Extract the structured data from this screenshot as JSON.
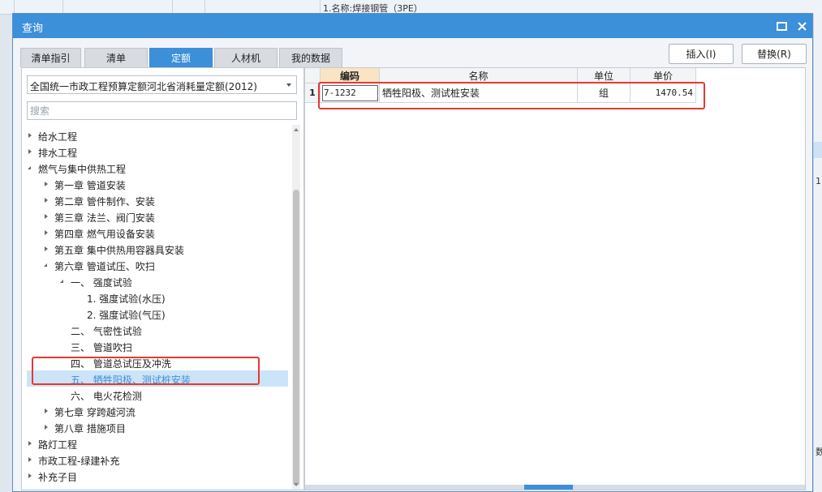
{
  "background": {
    "top_row_text": "1.名称:焊接钢管（3PE）",
    "right_texts": [
      "1",
      "数"
    ]
  },
  "dialog": {
    "title": "查询",
    "tabs": [
      {
        "label": "清单指引",
        "active": false
      },
      {
        "label": "清单",
        "active": false
      },
      {
        "label": "定额",
        "active": true
      },
      {
        "label": "人材机",
        "active": false
      },
      {
        "label": "我的数据",
        "active": false
      }
    ],
    "insert_label": "插入(I)",
    "replace_label": "替换(R)"
  },
  "left": {
    "library": "全国统一市政工程预算定额河北省消耗量定额(2012)",
    "search_placeholder": "搜索",
    "tree": [
      {
        "label": "给水工程",
        "toggle": "closed",
        "selected": false
      },
      {
        "label": "排水工程",
        "toggle": "closed",
        "selected": false
      },
      {
        "label": "燃气与集中供热工程",
        "toggle": "open",
        "selected": false
      },
      {
        "label": "第一章 管道安装",
        "toggle": "closed",
        "selected": false
      },
      {
        "label": "第二章 管件制作、安装",
        "toggle": "closed",
        "selected": false
      },
      {
        "label": "第三章 法兰、阀门安装",
        "toggle": "closed",
        "selected": false
      },
      {
        "label": "第四章 燃气用设备安装",
        "toggle": "closed",
        "selected": false
      },
      {
        "label": "第五章 集中供热用容器具安装",
        "toggle": "closed",
        "selected": false
      },
      {
        "label": "第六章 管道试压、吹扫",
        "toggle": "open",
        "selected": false
      },
      {
        "label": "一、 强度试验",
        "toggle": "open",
        "selected": false
      },
      {
        "label": "1. 强度试验(水压)",
        "toggle": "none",
        "selected": false
      },
      {
        "label": "2. 强度试验(气压)",
        "toggle": "none",
        "selected": false
      },
      {
        "label": "二、 气密性试验",
        "toggle": "none",
        "selected": false
      },
      {
        "label": "三、 管道吹扫",
        "toggle": "none",
        "selected": false
      },
      {
        "label": "四、 管道总试压及冲洗",
        "toggle": "none",
        "selected": false
      },
      {
        "label": "五、 牺牲阳极、测试桩安装",
        "toggle": "none",
        "selected": true
      },
      {
        "label": "六、 电火花检测",
        "toggle": "none",
        "selected": false
      },
      {
        "label": "第七章 穿跨越河流",
        "toggle": "closed",
        "selected": false
      },
      {
        "label": "第八章 措施项目",
        "toggle": "closed",
        "selected": false
      },
      {
        "label": "路灯工程",
        "toggle": "closed",
        "selected": false
      },
      {
        "label": "市政工程-绿建补充",
        "toggle": "closed",
        "selected": false
      },
      {
        "label": "补充子目",
        "toggle": "closed",
        "selected": false
      }
    ]
  },
  "grid": {
    "columns": [
      "编码",
      "名称",
      "单位",
      "单价"
    ],
    "rows": [
      {
        "num": "1",
        "code": "7-1232",
        "name": "牺牲阳极、测试桩安装",
        "unit": "组",
        "price": "1470.54"
      }
    ]
  },
  "colors": {
    "accent": "#3c8fd9",
    "highlight_box": "#e53935",
    "selection": "#cce4f7"
  }
}
